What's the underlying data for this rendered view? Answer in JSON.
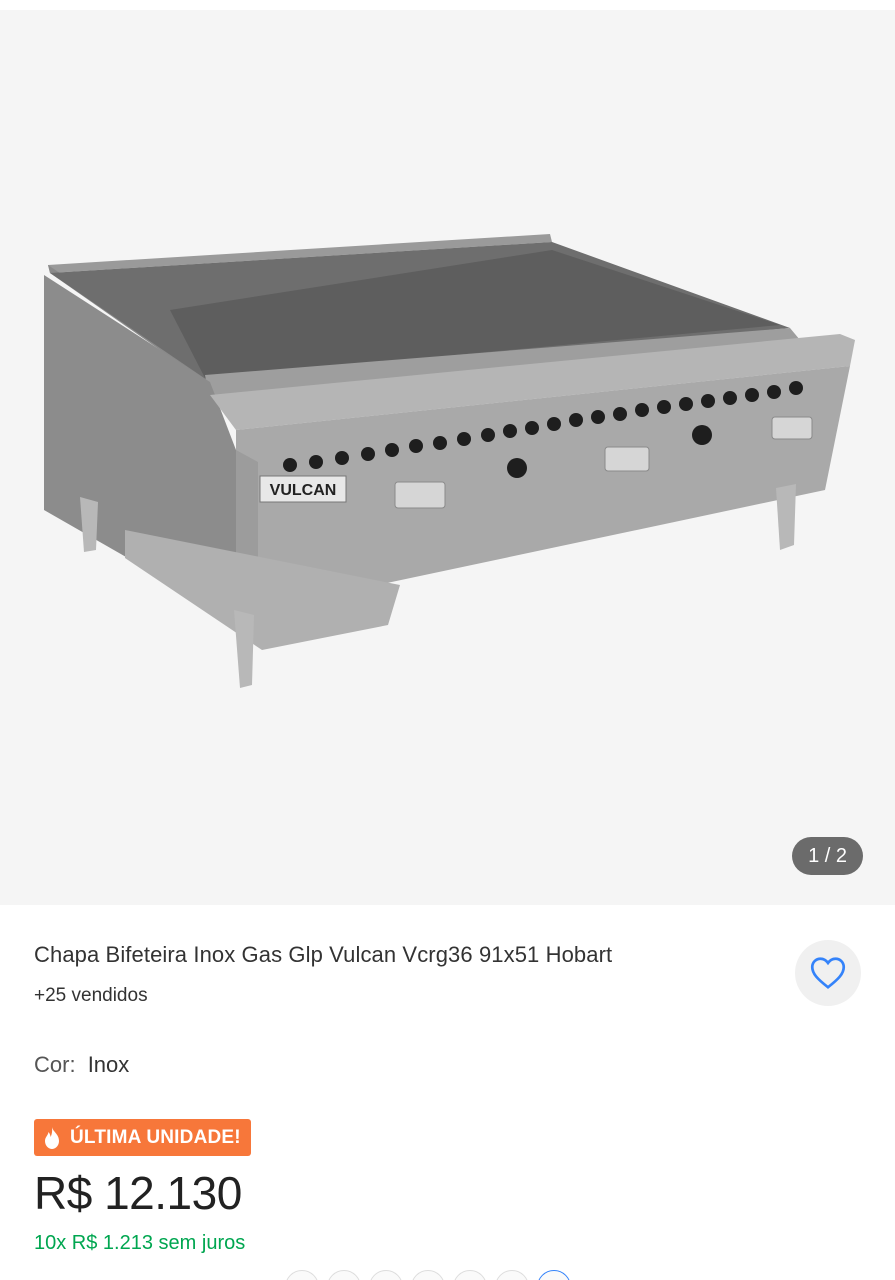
{
  "gallery": {
    "image_alt": "Chapa bifeteira inox",
    "brand_plate": "VULCAN",
    "counter": "1 / 2"
  },
  "product": {
    "title": "Chapa Bifeteira Inox Gas Glp Vulcan Vcrg36 91x51 Hobart",
    "sold": "+25 vendidos"
  },
  "variant": {
    "label": "Cor:",
    "value": "Inox"
  },
  "badge": {
    "text": "ÚLTIMA UNIDADE!"
  },
  "price": {
    "amount": "R$ 12.130",
    "installments": "10x R$ 1.213  sem juros"
  },
  "colors": {
    "badge": "#f7773a",
    "installments": "#00a650",
    "heart": "#3483fa"
  }
}
